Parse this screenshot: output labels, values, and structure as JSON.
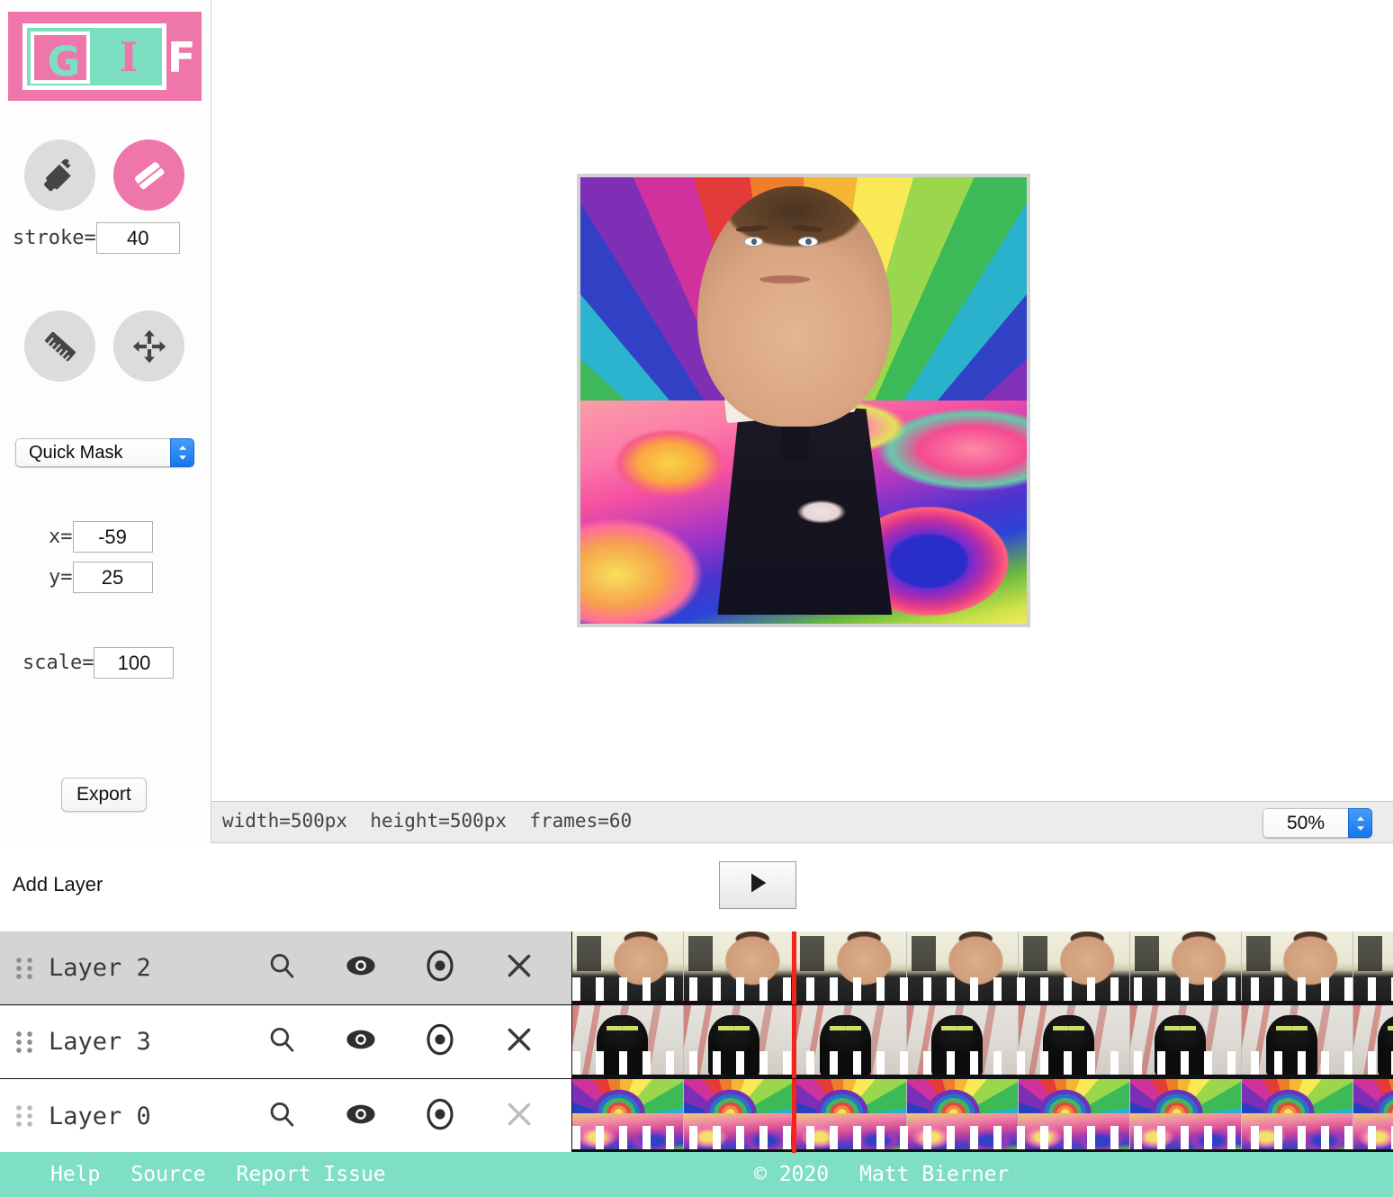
{
  "app": {
    "logo": {
      "g": "G",
      "i": "I",
      "f": "F",
      "pink": "#ef76ab",
      "teal": "#7fdfc4"
    }
  },
  "tools": {
    "brush": {
      "name": "paint-brush-tool",
      "label": "Brush",
      "active": false
    },
    "eraser": {
      "name": "eraser-tool",
      "label": "Eraser",
      "active": true
    },
    "ruler": {
      "name": "ruler-tool",
      "label": "Ruler",
      "active": false
    },
    "move": {
      "name": "move-tool",
      "label": "Move",
      "active": false
    }
  },
  "controls": {
    "stroke_label": "stroke=",
    "stroke_value": "40",
    "mask_mode": "Quick Mask",
    "mask_options": [
      "Quick Mask"
    ],
    "x_label": "x=",
    "x_value": "-59",
    "y_label": "y=",
    "y_value": "25",
    "scale_label": "scale=",
    "scale_value": "100",
    "export_label": "Export"
  },
  "status": {
    "text": "width=500px  height=500px  frames=60",
    "width": "width=500px",
    "height": "height=500px",
    "frames": "frames=60",
    "zoom": "50%",
    "zoom_options": [
      "50%"
    ]
  },
  "layers_toolbar": {
    "add_layer_label": "Add Layer",
    "play_label": "Play"
  },
  "layers": [
    {
      "name": "Layer 2",
      "selected": true,
      "search_icon": "magnifier-icon",
      "visible_icon": "eye-icon",
      "record_icon": "record-icon",
      "delete_icon": "close-icon",
      "delete_enabled": true,
      "strip": "man"
    },
    {
      "name": "Layer 3",
      "selected": false,
      "search_icon": "magnifier-icon",
      "visible_icon": "eye-icon",
      "record_icon": "record-icon",
      "delete_icon": "close-icon",
      "delete_enabled": true,
      "strip": "cat"
    },
    {
      "name": "Layer 0",
      "selected": false,
      "search_icon": "magnifier-icon",
      "visible_icon": "eye-icon",
      "record_icon": "record-icon",
      "delete_icon": "close-icon",
      "delete_enabled": false,
      "strip": "rainbow"
    }
  ],
  "footer": {
    "links": [
      "Help",
      "Source",
      "Report Issue"
    ],
    "copyright": "© 2020",
    "author": "Matt Bierner"
  }
}
